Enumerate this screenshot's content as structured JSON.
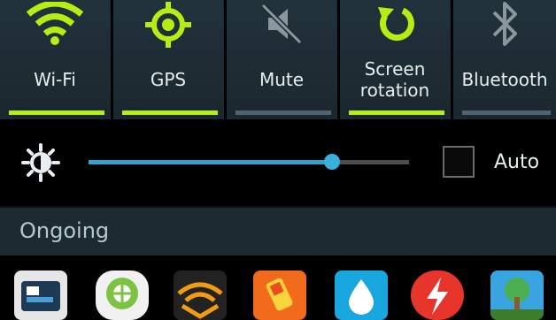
{
  "quick_toggles": [
    {
      "label": "Wi-Fi",
      "icon": "wifi-icon",
      "active": true
    },
    {
      "label": "GPS",
      "icon": "gps-icon",
      "active": true
    },
    {
      "label": "Mute",
      "icon": "mute-icon",
      "active": false
    },
    {
      "label": "Screen\nrotation",
      "icon": "screen-rotation-icon",
      "active": true
    },
    {
      "label": "Bluetooth",
      "icon": "bluetooth-icon",
      "active": false
    }
  ],
  "brightness": {
    "icon": "brightness-icon",
    "level": 0.76,
    "auto_label": "Auto",
    "auto_checked": false
  },
  "ongoing": {
    "title": "Ongoing",
    "apps": [
      {
        "icon": "screen-app-icon",
        "color": "#e6e6e6"
      },
      {
        "icon": "location-app-icon",
        "color": "#e8e8e8"
      },
      {
        "icon": "audible-app-icon",
        "color": "#222222"
      },
      {
        "icon": "battery-app-icon",
        "color": "#f26b1d"
      },
      {
        "icon": "water-drop-app-icon",
        "color": "#1aa7e0"
      },
      {
        "icon": "lightning-app-icon",
        "color": "#e8352b"
      },
      {
        "icon": "tree-game-app-icon",
        "color": "#3aa4e0"
      }
    ]
  },
  "colors": {
    "accent_on": "#b5ee14",
    "accent_off": "#4d6470",
    "slider": "#2fa2d0"
  }
}
